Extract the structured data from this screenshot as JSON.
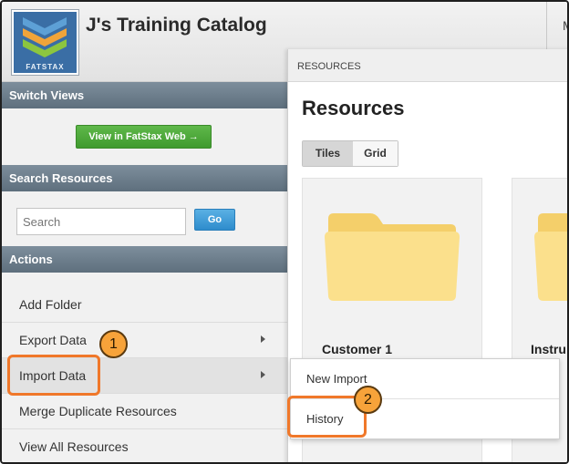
{
  "header": {
    "catalog_title": "J's Training Catalog",
    "logo_text": "FATSTAX",
    "cut_text": "M"
  },
  "sidebar": {
    "switch_views": {
      "title": "Switch Views",
      "button_label": "View in FatStax Web →"
    },
    "search": {
      "title": "Search Resources",
      "placeholder": "Search",
      "go_label": "Go"
    },
    "actions": {
      "title": "Actions",
      "items": [
        {
          "label": "Add Folder",
          "has_submenu": false
        },
        {
          "label": "Export Data",
          "has_submenu": true
        },
        {
          "label": "Import Data",
          "has_submenu": true
        },
        {
          "label": "Merge Duplicate Resources",
          "has_submenu": false
        },
        {
          "label": "View All Resources",
          "has_submenu": false
        }
      ]
    }
  },
  "resources": {
    "breadcrumb": "RESOURCES",
    "title": "Resources",
    "view_toggle": {
      "tiles": "Tiles",
      "grid": "Grid",
      "selected": "Tiles"
    },
    "tiles": [
      {
        "name": "Customer 1",
        "icon": "folder-icon"
      },
      {
        "name": "Instru",
        "icon": "folder-icon"
      }
    ]
  },
  "submenu": {
    "items": [
      {
        "label": "New Import"
      },
      {
        "label": "History"
      }
    ]
  },
  "annotations": {
    "badge_1": "1",
    "badge_2": "2",
    "highlight_color": "#f0782a",
    "badge_color": "#f7a33a"
  }
}
